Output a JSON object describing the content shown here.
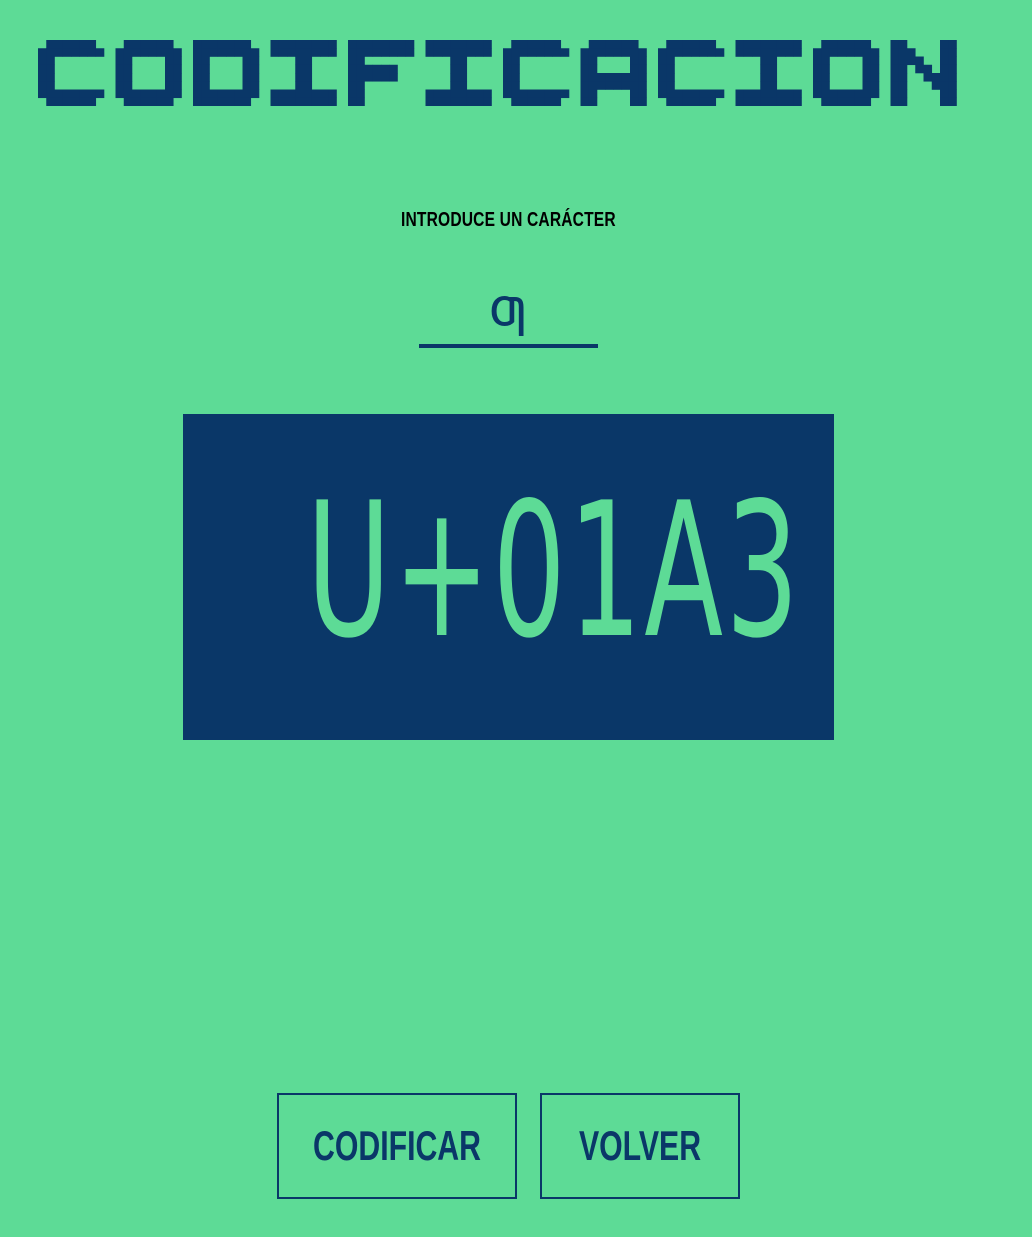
{
  "header": {
    "title": "CODIFICACION"
  },
  "form": {
    "prompt_label": "INTRODUCE UN CARÁCTER",
    "char_value": "ƣ"
  },
  "result": {
    "code": "U+01A3"
  },
  "actions": {
    "encode_label": "CODIFICAR",
    "back_label": "VOLVER"
  },
  "colors": {
    "background": "#5ddb96",
    "accent": "#0a3768",
    "label": "#000000"
  }
}
